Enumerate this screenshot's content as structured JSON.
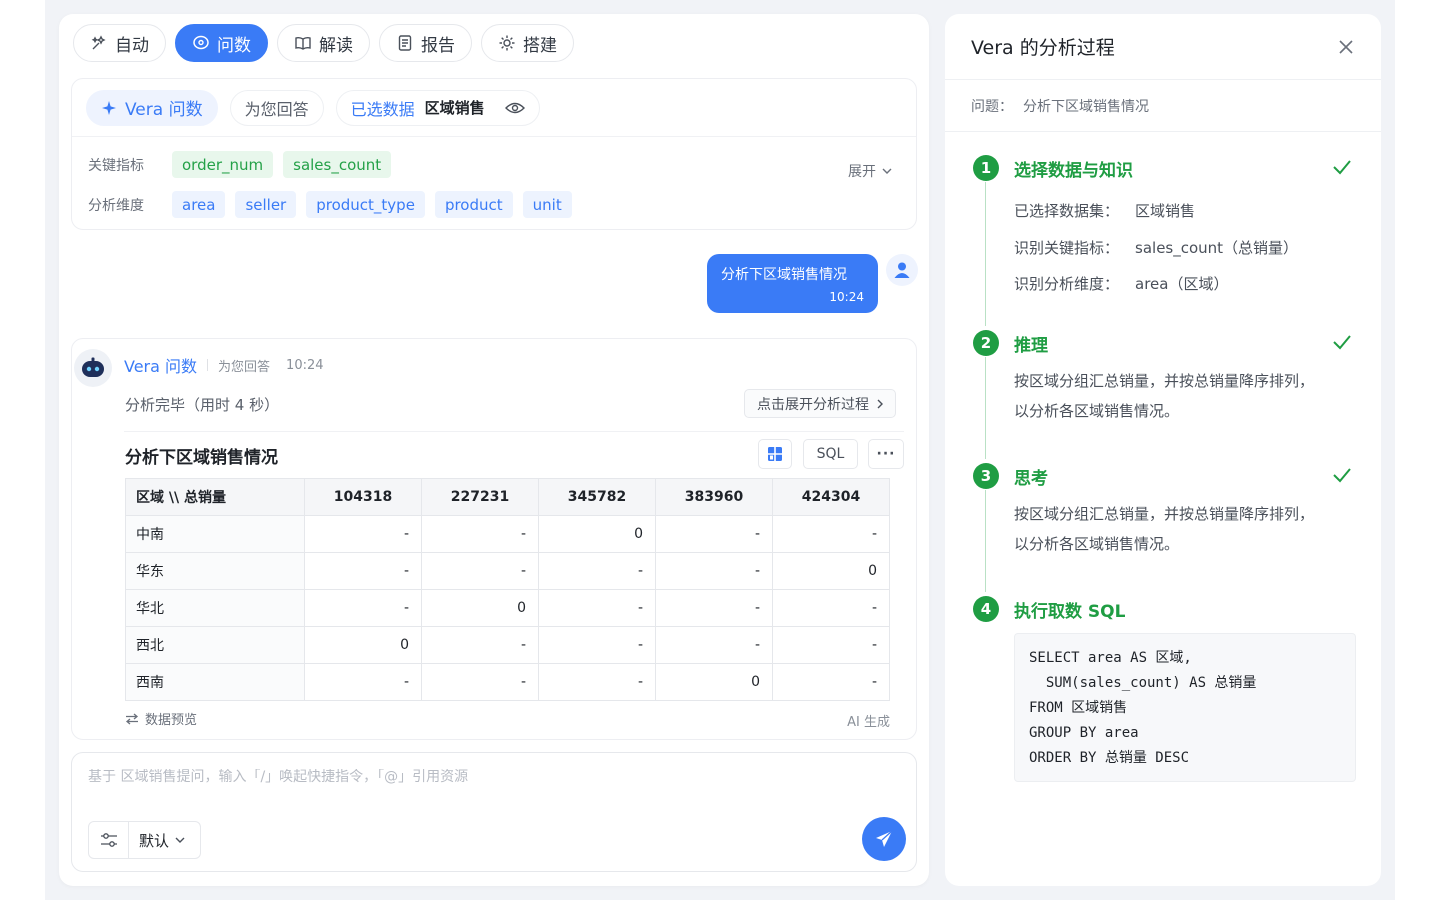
{
  "mode_tabs": [
    {
      "label": "自动",
      "icon": "auto-icon"
    },
    {
      "label": "问数",
      "icon": "chat-bubble-icon"
    },
    {
      "label": "解读",
      "icon": "book-icon"
    },
    {
      "label": "报告",
      "icon": "document-icon"
    },
    {
      "label": "搭建",
      "icon": "gear-icon"
    }
  ],
  "active_mode": "问数",
  "context": {
    "vera_label": "Vera 问数",
    "answer_for_you": "为您回答",
    "selected_data_label": "已选数据",
    "selected_dataset": "区域销售",
    "metrics_label": "关键指标",
    "metrics": [
      "order_num",
      "sales_count"
    ],
    "dimensions_label": "分析维度",
    "dimensions": [
      "area",
      "seller",
      "product_type",
      "product",
      "unit"
    ],
    "expand_label": "展开"
  },
  "user_message": {
    "text": "分析下区域销售情况",
    "time": "10:24"
  },
  "answer": {
    "bot_name": "Vera 问数",
    "subtitle": "为您回答",
    "time": "10:24",
    "status": "分析完毕（用时 4 秒）",
    "expand_process_label": "点击展开分析过程",
    "title": "分析下区域销售情况",
    "sql_button": "SQL",
    "more_button": "···",
    "table": {
      "header": [
        "区域 \\\\ 总销量",
        "104318",
        "227231",
        "345782",
        "383960",
        "424304"
      ],
      "rows": [
        [
          "中南",
          "-",
          "-",
          "0",
          "-",
          "-"
        ],
        [
          "华东",
          "-",
          "-",
          "-",
          "-",
          "0"
        ],
        [
          "华北",
          "-",
          "0",
          "-",
          "-",
          "-"
        ],
        [
          "西北",
          "0",
          "-",
          "-",
          "-",
          "-"
        ],
        [
          "西南",
          "-",
          "-",
          "-",
          "0",
          "-"
        ]
      ]
    },
    "preview_label": "数据预览",
    "ai_generated_label": "AI 生成"
  },
  "input": {
    "placeholder": "基于 区域销售提问，输入「/」唤起快捷指令，「@」引用资源",
    "value": "",
    "model_label": "默认"
  },
  "side_panel": {
    "title": "Vera 的分析过程",
    "question_label": "问题：",
    "question": "分析下区域销售情况",
    "steps": [
      {
        "num": "1",
        "title": "选择数据与知识",
        "items": [
          {
            "k": "已选择数据集：",
            "v": "区域销售"
          },
          {
            "k": "识别关键指标：",
            "v": "sales_count（总销量）"
          },
          {
            "k": "识别分析维度：",
            "v": "area（区域）"
          }
        ]
      },
      {
        "num": "2",
        "title": "推理",
        "text": [
          "按区域分组汇总销量，并按总销量降序排列，",
          "以分析各区域销售情况。"
        ]
      },
      {
        "num": "3",
        "title": "思考",
        "text": [
          "按区域分组汇总销量，并按总销量降序排列，",
          "以分析各区域销售情况。"
        ]
      },
      {
        "num": "4",
        "title": "执行取数 SQL",
        "sql": [
          "SELECT area AS 区域,",
          "  SUM(sales_count) AS 总销量",
          "FROM 区域销售",
          "GROUP BY area",
          "ORDER BY 总销量 DESC"
        ]
      }
    ]
  },
  "colors": {
    "accent": "#3a7bf6",
    "success": "#1f9d43",
    "metric_tag": "#e8f7ec",
    "dimension_tag": "#edf3fe"
  }
}
